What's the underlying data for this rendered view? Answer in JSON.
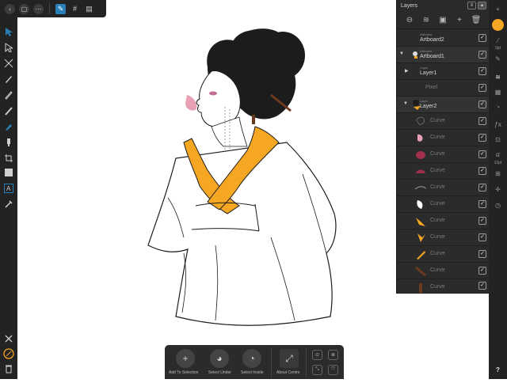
{
  "toolbar": {
    "icons": [
      "back-icon",
      "document-icon",
      "more-icon",
      "persona-icon",
      "grid-icon",
      "export-icon"
    ]
  },
  "tools": [
    "move-tool",
    "node-tool",
    "corner-tool",
    "pen-tool",
    "pencil-tool",
    "vector-brush-tool",
    "fill-tool",
    "transparency-tool",
    "place-image-tool",
    "crop-tool",
    "shape-tool",
    "artistic-text-tool",
    "color-picker-tool"
  ],
  "right_strip": {
    "stroke_value": "0pt",
    "font_size": "12pt",
    "help": "?"
  },
  "layers_panel": {
    "title": "Layers",
    "rows": [
      {
        "type": "Artboard",
        "name": "Artboard2"
      },
      {
        "type": "Artboard",
        "name": "Artboard1"
      },
      {
        "type": "Layer",
        "name": "Layer1"
      },
      {
        "type": "",
        "name": "Pixel"
      },
      {
        "type": "Layer",
        "name": "Layer2"
      },
      {
        "type": "",
        "name": "Curve"
      },
      {
        "type": "",
        "name": "Curve"
      },
      {
        "type": "",
        "name": "Curve"
      },
      {
        "type": "",
        "name": "Curve"
      },
      {
        "type": "",
        "name": "Curve"
      },
      {
        "type": "",
        "name": "Curve"
      },
      {
        "type": "",
        "name": "Curve"
      },
      {
        "type": "",
        "name": "Curve"
      },
      {
        "type": "",
        "name": "Curve"
      },
      {
        "type": "",
        "name": "Curve"
      },
      {
        "type": "",
        "name": "Curve"
      }
    ]
  },
  "bottom_bar": {
    "add_to_selection": "Add To Selection",
    "select_under": "Select Under",
    "select_inside": "Select Inside",
    "about_centre": "About Centre"
  },
  "colors": {
    "kimono_accent": "#f5a623",
    "ui_dark": "#232323",
    "selection_blue": "#2a7fb8",
    "color_swatch": "#f5a623"
  }
}
